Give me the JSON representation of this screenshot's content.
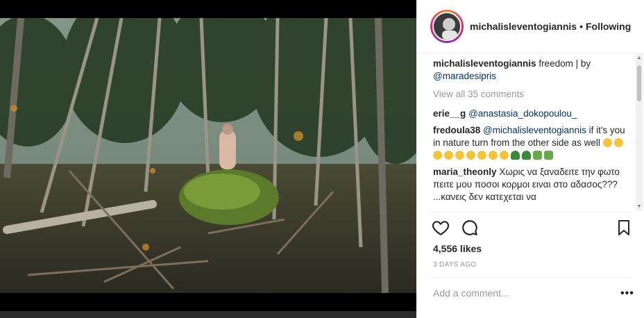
{
  "post": {
    "username": "michalisleventogiannis",
    "separator": "•",
    "follow_status": "Following",
    "caption": {
      "username": "michalisleventogiannis",
      "text": "freedom | by",
      "mention": "@maradesipris"
    },
    "view_all_comments": "View all 35 comments",
    "comments": [
      {
        "username": "erie__g",
        "mention": "@anastasia_dokopoulou_",
        "text": ""
      },
      {
        "username": "fredoula38",
        "mention": "@michalisleventogiannis",
        "text": "if it's you in nature turn from the other side as well"
      },
      {
        "username": "maria_theonly",
        "mention": "",
        "text": "Χωρις να ξαναδειτε την φωτο πειτε μου ποσοι κορμοι ειναι στο αδασος??? ...κανεις δεν κατεχεται να"
      }
    ],
    "likes": "4,556 likes",
    "time_ago": "3 DAYS AGO",
    "add_comment_placeholder": "Add a comment...",
    "more_options": "•••"
  },
  "icons": [
    "heart-icon",
    "comment-icon",
    "bookmark-icon",
    "more-options-icon"
  ],
  "colors": {
    "mention": "#003569",
    "text": "#262626",
    "muted": "#999999"
  }
}
